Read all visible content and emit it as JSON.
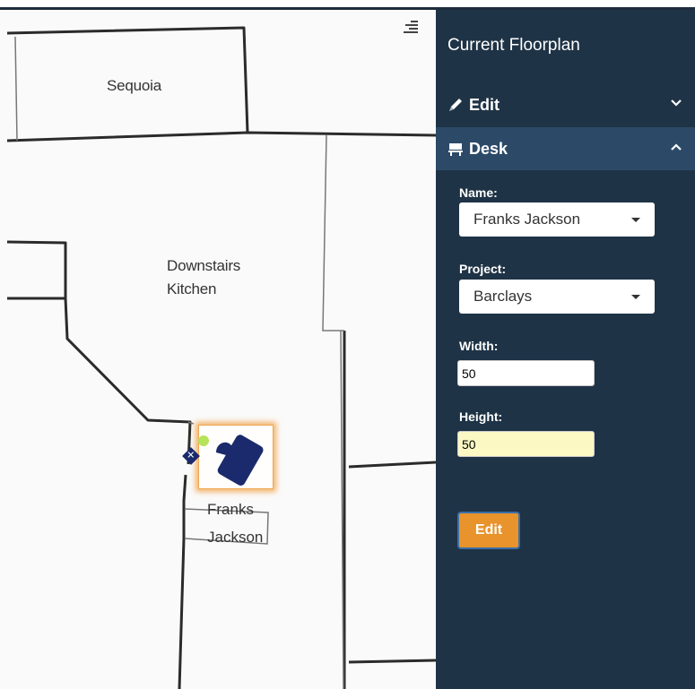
{
  "floorplan": {
    "rooms": [
      {
        "name": "Sequoia"
      },
      {
        "name": "Downstairs Kitchen",
        "lines": [
          "Downstairs",
          "Kitchen"
        ]
      }
    ],
    "desk": {
      "occupant_lines": [
        "Franks",
        "Jackson"
      ],
      "handle_color": "#b6e35a",
      "selection_color": "#f3b36a",
      "icon": "desk-icon",
      "delete_icon": "close-icon"
    },
    "menu_icon": "hamburger-menu-icon"
  },
  "panel": {
    "title": "Current Floorplan",
    "sections": {
      "edit": {
        "label": "Edit",
        "icon": "pencil-icon",
        "chevron": "chevron-down-icon"
      },
      "desk": {
        "label": "Desk",
        "icon": "desk-icon",
        "chevron": "chevron-up-icon"
      }
    },
    "form": {
      "name_label": "Name:",
      "name_value": "Franks Jackson",
      "project_label": "Project:",
      "project_value": "Barclays",
      "width_label": "Width:",
      "width_value": "50",
      "height_label": "Height:",
      "height_value": "50",
      "submit_label": "Edit"
    }
  },
  "colors": {
    "panel_bg": "#1f3346",
    "active_section_bg": "#2c4a68",
    "button_orange": "#e8932b",
    "desk_navy": "#1a2a6c"
  }
}
